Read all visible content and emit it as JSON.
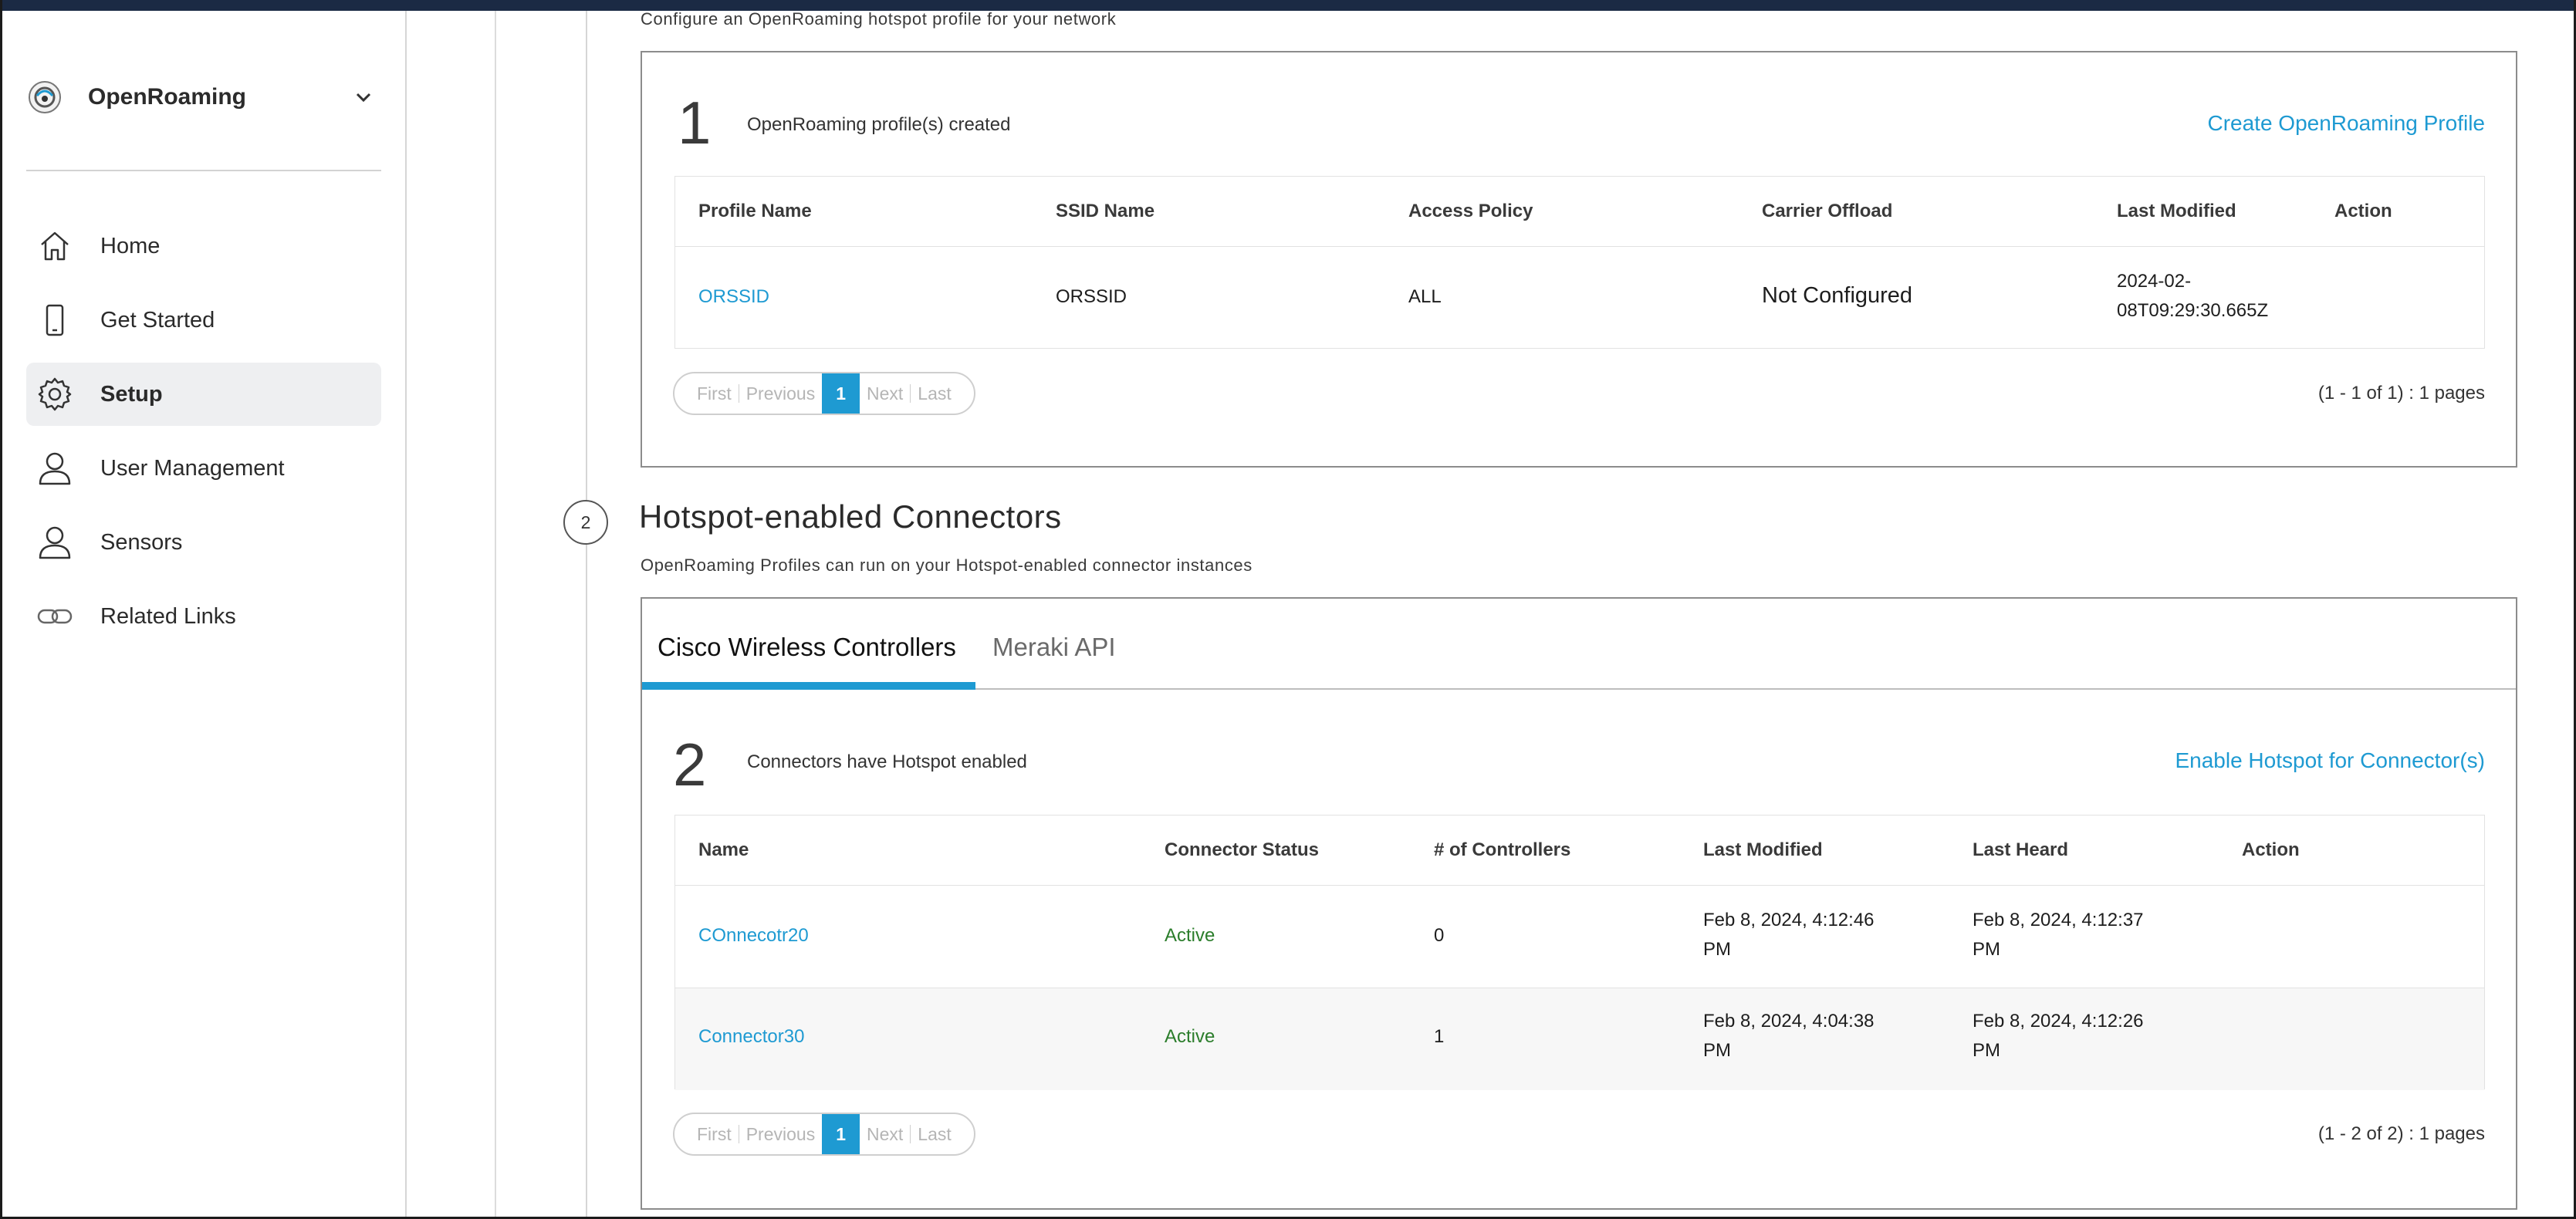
{
  "sidebar": {
    "org_name": "OpenRoaming",
    "items": [
      {
        "label": "Home",
        "icon": "home-icon"
      },
      {
        "label": "Get Started",
        "icon": "phone-icon"
      },
      {
        "label": "Setup",
        "icon": "gear-icon",
        "active": true
      },
      {
        "label": "User Management",
        "icon": "user-icon"
      },
      {
        "label": "Sensors",
        "icon": "user-icon"
      },
      {
        "label": "Related Links",
        "icon": "link-icon"
      }
    ]
  },
  "profiles": {
    "subtitle": "Configure an OpenRoaming hotspot profile for your network",
    "count": "1",
    "count_text": "OpenRoaming profile(s) created",
    "create_link": "Create OpenRoaming Profile",
    "headers": [
      "Profile Name",
      "SSID Name",
      "Access Policy",
      "Carrier Offload",
      "Last Modified",
      "Action"
    ],
    "rows": [
      {
        "profile_name": "ORSSID",
        "ssid_name": "ORSSID",
        "access_policy": "ALL",
        "carrier_offload": "Not Configured",
        "last_modified_1": "2024-02-",
        "last_modified_2": "08T09:29:30.665Z",
        "action": ""
      }
    ],
    "pager": {
      "first": "First",
      "previous": "Previous",
      "current": "1",
      "next": "Next",
      "last": "Last"
    },
    "pages_text": "(1 - 1 of 1) : 1 pages"
  },
  "connectors": {
    "step": "2",
    "title": "Hotspot-enabled Connectors",
    "subtitle": "OpenRoaming Profiles can run on your Hotspot-enabled connector instances",
    "tabs": [
      "Cisco Wireless Controllers",
      "Meraki API"
    ],
    "active_tab": "Cisco Wireless Controllers",
    "count": "2",
    "count_text": "Connectors have Hotspot enabled",
    "enable_link": "Enable Hotspot for Connector(s)",
    "headers": [
      "Name",
      "Connector Status",
      "# of Controllers",
      "Last Modified",
      "Last Heard",
      "Action"
    ],
    "rows": [
      {
        "name": "COnnecotr20",
        "status": "Active",
        "controllers": "0",
        "last_modified_1": "Feb 8, 2024, 4:12:46",
        "last_modified_2": "PM",
        "last_heard_1": "Feb 8, 2024, 4:12:37",
        "last_heard_2": "PM"
      },
      {
        "name": "Connector30",
        "status": "Active",
        "controllers": "1",
        "last_modified_1": "Feb 8, 2024, 4:04:38",
        "last_modified_2": "PM",
        "last_heard_1": "Feb 8, 2024, 4:12:26",
        "last_heard_2": "PM"
      }
    ],
    "pager": {
      "first": "First",
      "previous": "Previous",
      "current": "1",
      "next": "Next",
      "last": "Last"
    },
    "pages_text": "(1 - 2 of 2) : 1 pages"
  },
  "colors": {
    "accent": "#1e9ad2",
    "active_status": "#2b7d2b",
    "topbar": "#1b2a44"
  }
}
